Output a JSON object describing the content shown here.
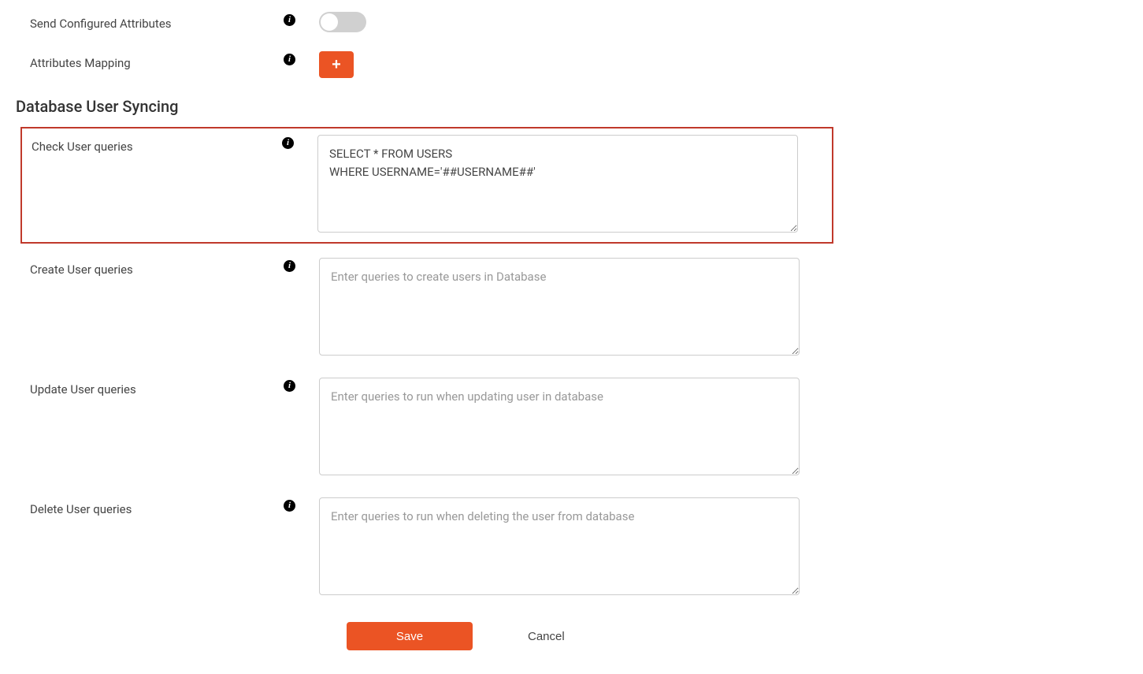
{
  "rows": {
    "sendConfiguredAttributes": {
      "label": "Send Configured Attributes"
    },
    "attributesMapping": {
      "label": "Attributes Mapping"
    }
  },
  "section": {
    "heading": "Database User Syncing",
    "checkUser": {
      "label": "Check User queries",
      "value": "SELECT * FROM USERS\nWHERE USERNAME='##USERNAME##'"
    },
    "createUser": {
      "label": "Create User queries",
      "placeholder": "Enter queries to create users in Database"
    },
    "updateUser": {
      "label": "Update User queries",
      "placeholder": "Enter queries to run when updating user in database"
    },
    "deleteUser": {
      "label": "Delete User queries",
      "placeholder": "Enter queries to run when deleting the user from database"
    }
  },
  "buttons": {
    "save": "Save",
    "cancel": "Cancel"
  },
  "icons": {
    "info": "i",
    "plus": "+"
  }
}
